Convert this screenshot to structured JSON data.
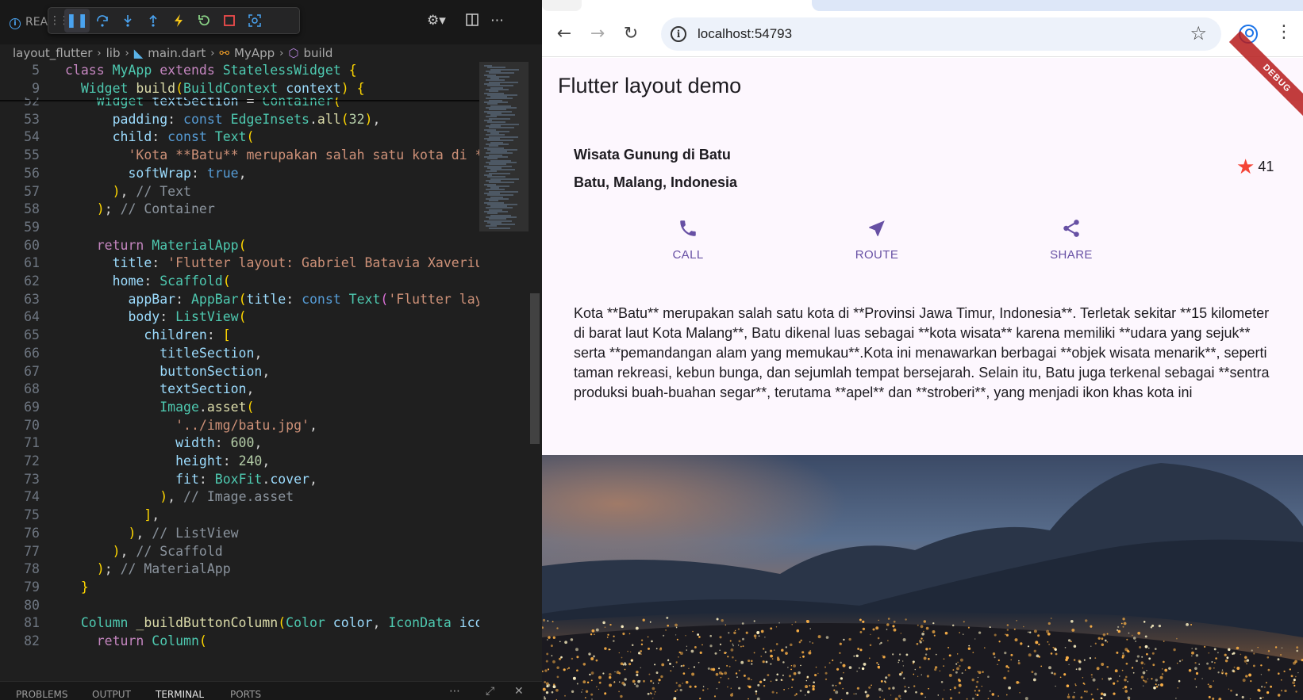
{
  "vscode": {
    "tab_label": "REA",
    "breadcrumb": [
      "layout_flutter",
      "lib",
      "main.dart",
      "MyApp",
      "build"
    ],
    "panel_tabs": [
      "PROBLEMS",
      "OUTPUT",
      "TERMINAL",
      "PORTS"
    ],
    "sticky_lines": [
      {
        "n": "5",
        "code": "class MyApp extends StatelessWidget {"
      },
      {
        "n": "9",
        "code": "  Widget build(BuildContext context) {"
      }
    ],
    "lines": [
      {
        "n": "52",
        "code": "    Widget textSection = Container("
      },
      {
        "n": "53",
        "code": "      padding: const EdgeInsets.all(32),"
      },
      {
        "n": "54",
        "code": "      child: const Text("
      },
      {
        "n": "55",
        "code": "        'Kota **Batu** merupakan salah satu kota di **"
      },
      {
        "n": "56",
        "code": "        softWrap: true,"
      },
      {
        "n": "57",
        "code": "      ), // Text"
      },
      {
        "n": "58",
        "code": "    ); // Container"
      },
      {
        "n": "59",
        "code": ""
      },
      {
        "n": "60",
        "code": "    return MaterialApp("
      },
      {
        "n": "61",
        "code": "      title: 'Flutter layout: Gabriel Batavia Xaverius"
      },
      {
        "n": "62",
        "code": "      home: Scaffold("
      },
      {
        "n": "63",
        "code": "        appBar: AppBar(title: const Text('Flutter layo"
      },
      {
        "n": "64",
        "code": "        body: ListView("
      },
      {
        "n": "65",
        "code": "          children: ["
      },
      {
        "n": "66",
        "code": "            titleSection,"
      },
      {
        "n": "67",
        "code": "            buttonSection,"
      },
      {
        "n": "68",
        "code": "            textSection,"
      },
      {
        "n": "69",
        "code": "            Image.asset("
      },
      {
        "n": "70",
        "code": "              '../img/batu.jpg',"
      },
      {
        "n": "71",
        "code": "              width: 600,"
      },
      {
        "n": "72",
        "code": "              height: 240,"
      },
      {
        "n": "73",
        "code": "              fit: BoxFit.cover,"
      },
      {
        "n": "74",
        "code": "            ), // Image.asset"
      },
      {
        "n": "75",
        "code": "          ],"
      },
      {
        "n": "76",
        "code": "        ), // ListView"
      },
      {
        "n": "77",
        "code": "      ), // Scaffold"
      },
      {
        "n": "78",
        "code": "    ); // MaterialApp"
      },
      {
        "n": "79",
        "code": "  }"
      },
      {
        "n": "80",
        "code": ""
      },
      {
        "n": "81",
        "code": "  Column _buildButtonColumn(Color color, IconData icon"
      },
      {
        "n": "82",
        "code": "    return Column("
      }
    ],
    "debug_controls": [
      "drag-handle-icon",
      "pause-icon",
      "step-over-icon",
      "step-into-icon",
      "step-out-icon",
      "hot-reload-icon",
      "restart-icon",
      "stop-icon",
      "inspect-icon"
    ]
  },
  "browser": {
    "url": "localhost:54793",
    "app": {
      "appbar_title": "Flutter layout demo",
      "debug_banner": "DEBUG",
      "title_line1": "Wisata Gunung di Batu",
      "title_line2": "Batu, Malang, Indonesia",
      "rating_count": "41",
      "buttons": [
        {
          "icon": "call-icon",
          "label": "CALL"
        },
        {
          "icon": "route-icon",
          "label": "ROUTE"
        },
        {
          "icon": "share-icon",
          "label": "SHARE"
        }
      ],
      "description": "Kota **Batu** merupakan salah satu kota di **Provinsi Jawa Timur, Indonesia**. Terletak sekitar **15 kilometer di barat laut Kota Malang**, Batu dikenal luas sebagai **kota wisata** karena memiliki **udara yang sejuk** serta **pemandangan alam yang memukau**.Kota ini menawarkan berbagai **objek wisata menarik**, seperti taman rekreasi, kebun bunga, dan sejumlah tempat bersejarah. Selain itu, Batu juga terkenal sebagai **sentra produksi buah-buahan segar**, terutama **apel** dan **stroberi**, yang menjadi ikon khas kota ini"
    },
    "colors": {
      "accent": "#6750a4",
      "star": "#f44336",
      "app_bg": "#fdf7fe"
    }
  }
}
